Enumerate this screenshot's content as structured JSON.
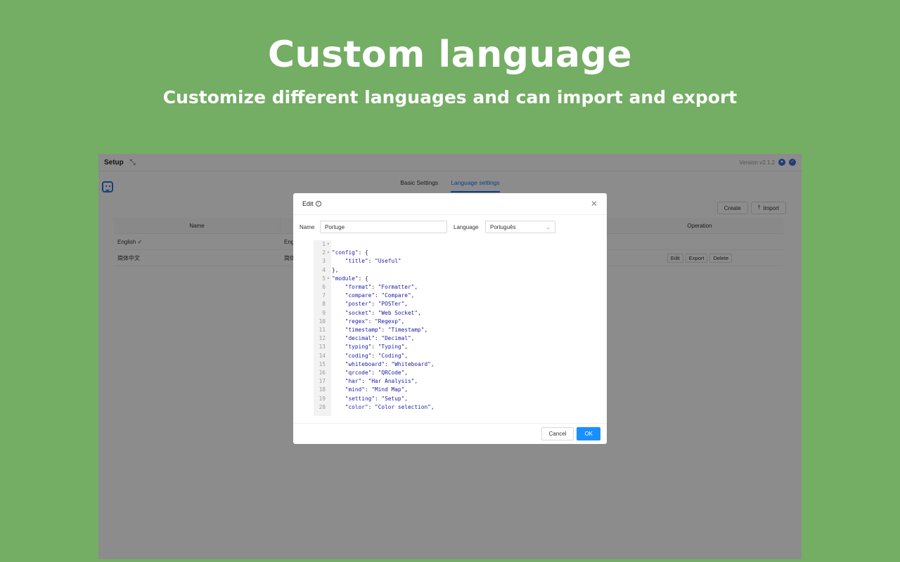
{
  "hero": {
    "title": "Custom language",
    "subtitle": "Customize different languages and can import and export"
  },
  "app": {
    "title": "Setup",
    "version": "Version v2.1.2",
    "tabs": [
      {
        "label": "Basic Settings",
        "active": false
      },
      {
        "label": "Language settings",
        "active": true
      }
    ],
    "toolbar": {
      "create_label": "Create",
      "import_label": "Import"
    },
    "table": {
      "headers": {
        "name": "Name",
        "operation": "Operation"
      },
      "rows": [
        {
          "name": "English ✓",
          "mid": "Eng"
        },
        {
          "name": "简体中文",
          "mid": "简体",
          "actions": [
            "Edit",
            "Export",
            "Delete"
          ]
        }
      ]
    }
  },
  "modal": {
    "title": "Edit",
    "name_label": "Name",
    "name_value": "Portuge",
    "language_label": "Language",
    "language_value": "Português",
    "cancel_label": "Cancel",
    "ok_label": "OK",
    "code_lines": [
      {
        "n": "1",
        "fold": true,
        "text": ""
      },
      {
        "n": "2",
        "fold": true,
        "text": "\"config\": {"
      },
      {
        "n": "3",
        "fold": false,
        "text": "    \"title\": \"Useful\""
      },
      {
        "n": "4",
        "fold": false,
        "text": "},"
      },
      {
        "n": "5",
        "fold": true,
        "text": "\"module\": {"
      },
      {
        "n": "6",
        "fold": false,
        "text": "    \"format\": \"Formatter\","
      },
      {
        "n": "7",
        "fold": false,
        "text": "    \"compare\": \"Compare\","
      },
      {
        "n": "8",
        "fold": false,
        "text": "    \"poster\": \"POSTer\","
      },
      {
        "n": "9",
        "fold": false,
        "text": "    \"socket\": \"Web Socket\","
      },
      {
        "n": "10",
        "fold": false,
        "text": "    \"regex\": \"Regexp\","
      },
      {
        "n": "11",
        "fold": false,
        "text": "    \"timestamp\": \"Timestamp\","
      },
      {
        "n": "12",
        "fold": false,
        "text": "    \"decimal\": \"Decimal\","
      },
      {
        "n": "13",
        "fold": false,
        "text": "    \"typing\": \"Typing\","
      },
      {
        "n": "14",
        "fold": false,
        "text": "    \"coding\": \"Coding\","
      },
      {
        "n": "15",
        "fold": false,
        "text": "    \"whiteboard\": \"Whiteboard\","
      },
      {
        "n": "16",
        "fold": false,
        "text": "    \"qrcode\": \"QRCode\","
      },
      {
        "n": "17",
        "fold": false,
        "text": "    \"har\": \"Har Analysis\","
      },
      {
        "n": "18",
        "fold": false,
        "text": "    \"mind\": \"Mind Map\","
      },
      {
        "n": "19",
        "fold": false,
        "text": "    \"setting\": \"Setup\","
      },
      {
        "n": "20",
        "fold": false,
        "text": "    \"color\": \"Color selection\","
      }
    ]
  },
  "colors": {
    "background": "#74ad64",
    "accent": "#1890ff"
  }
}
